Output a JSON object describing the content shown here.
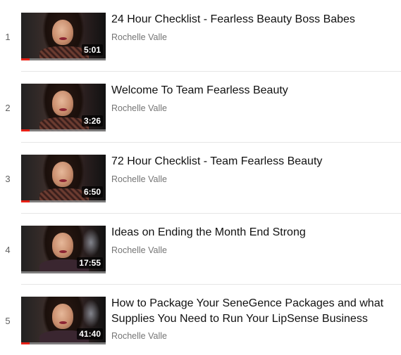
{
  "playlist": {
    "items": [
      {
        "index": "1",
        "title": "24 Hour Checklist - Fearless Beauty Boss Babes",
        "channel": "Rochelle Valle",
        "duration": "5:01",
        "watched_fraction": 0.1
      },
      {
        "index": "2",
        "title": "Welcome To Team Fearless Beauty",
        "channel": "Rochelle Valle",
        "duration": "3:26",
        "watched_fraction": 0.1
      },
      {
        "index": "3",
        "title": "72 Hour Checklist - Team Fearless Beauty",
        "channel": "Rochelle Valle",
        "duration": "6:50",
        "watched_fraction": 0.1
      },
      {
        "index": "4",
        "title": "Ideas on Ending the Month End Strong",
        "channel": "Rochelle Valle",
        "duration": "17:55",
        "watched_fraction": 0
      },
      {
        "index": "5",
        "title": "How to Package Your SeneGence Packages and what Supplies You Need to Run Your LipSense Business",
        "channel": "Rochelle Valle",
        "duration": "41:40",
        "watched_fraction": 0.1
      }
    ]
  },
  "colors": {
    "progress": "#e62117",
    "title": "#111111",
    "channel": "#757575"
  }
}
